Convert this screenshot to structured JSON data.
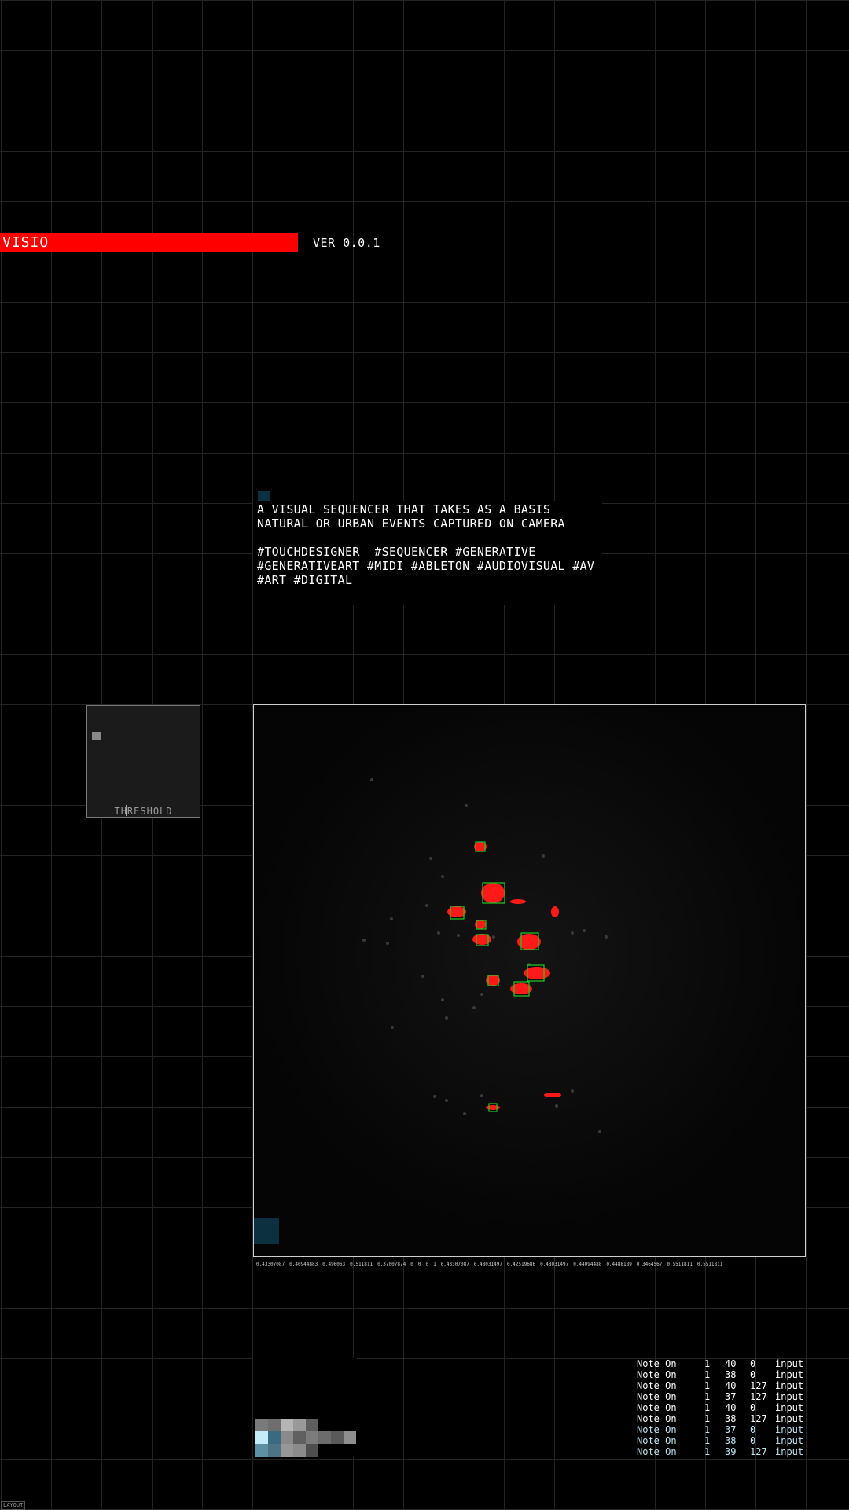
{
  "app": {
    "title": "VISIO",
    "version": "VER 0.0.1"
  },
  "description": {
    "text": "A VISUAL SEQUENCER THAT TAKES AS A BASIS NATURAL OR URBAN EVENTS CAPTURED ON CAMERA",
    "tags": "#TOUCHDESIGNER  #SEQUENCER #GENERATIVE #GENERATIVEART #MIDI #ABLETON #AUDIOVISUAL #AV #ART #DIGITAL"
  },
  "threshold": {
    "label": "THRESHOLD"
  },
  "values_row": [
    "0.43307087",
    "0.40944883",
    "0.496063",
    "0.511811",
    "0.37007874",
    "0",
    "0",
    "0",
    "1",
    "0.43307087",
    "0.48031497",
    "0.42519686",
    "0.48031497",
    "0.44094488",
    "0.4488189",
    "0.3464567",
    "0.5511811",
    "0.5511811"
  ],
  "midi_log": [
    {
      "type": "Note On",
      "ch": "1",
      "note": "40",
      "vel": "0",
      "src": "input"
    },
    {
      "type": "Note On",
      "ch": "1",
      "note": "38",
      "vel": "0",
      "src": "input"
    },
    {
      "type": "Note On",
      "ch": "1",
      "note": "40",
      "vel": "127",
      "src": "input"
    },
    {
      "type": "Note On",
      "ch": "1",
      "note": "37",
      "vel": "127",
      "src": "input"
    },
    {
      "type": "Note On",
      "ch": "1",
      "note": "40",
      "vel": "0",
      "src": "input"
    },
    {
      "type": "Note On",
      "ch": "1",
      "note": "38",
      "vel": "127",
      "src": "input"
    },
    {
      "type": "Note On",
      "ch": "1",
      "note": "37",
      "vel": "0",
      "src": "input"
    },
    {
      "type": "Note On",
      "ch": "1",
      "note": "38",
      "vel": "0",
      "src": "input"
    },
    {
      "type": "Note On",
      "ch": "1",
      "note": "39",
      "vel": "127",
      "src": "input"
    }
  ],
  "layout_tag": "LAYOUT",
  "colors": {
    "accent": "#ff0000",
    "detection_box": "#22cc22",
    "marker": "#0d3040",
    "grid": "#242424"
  }
}
